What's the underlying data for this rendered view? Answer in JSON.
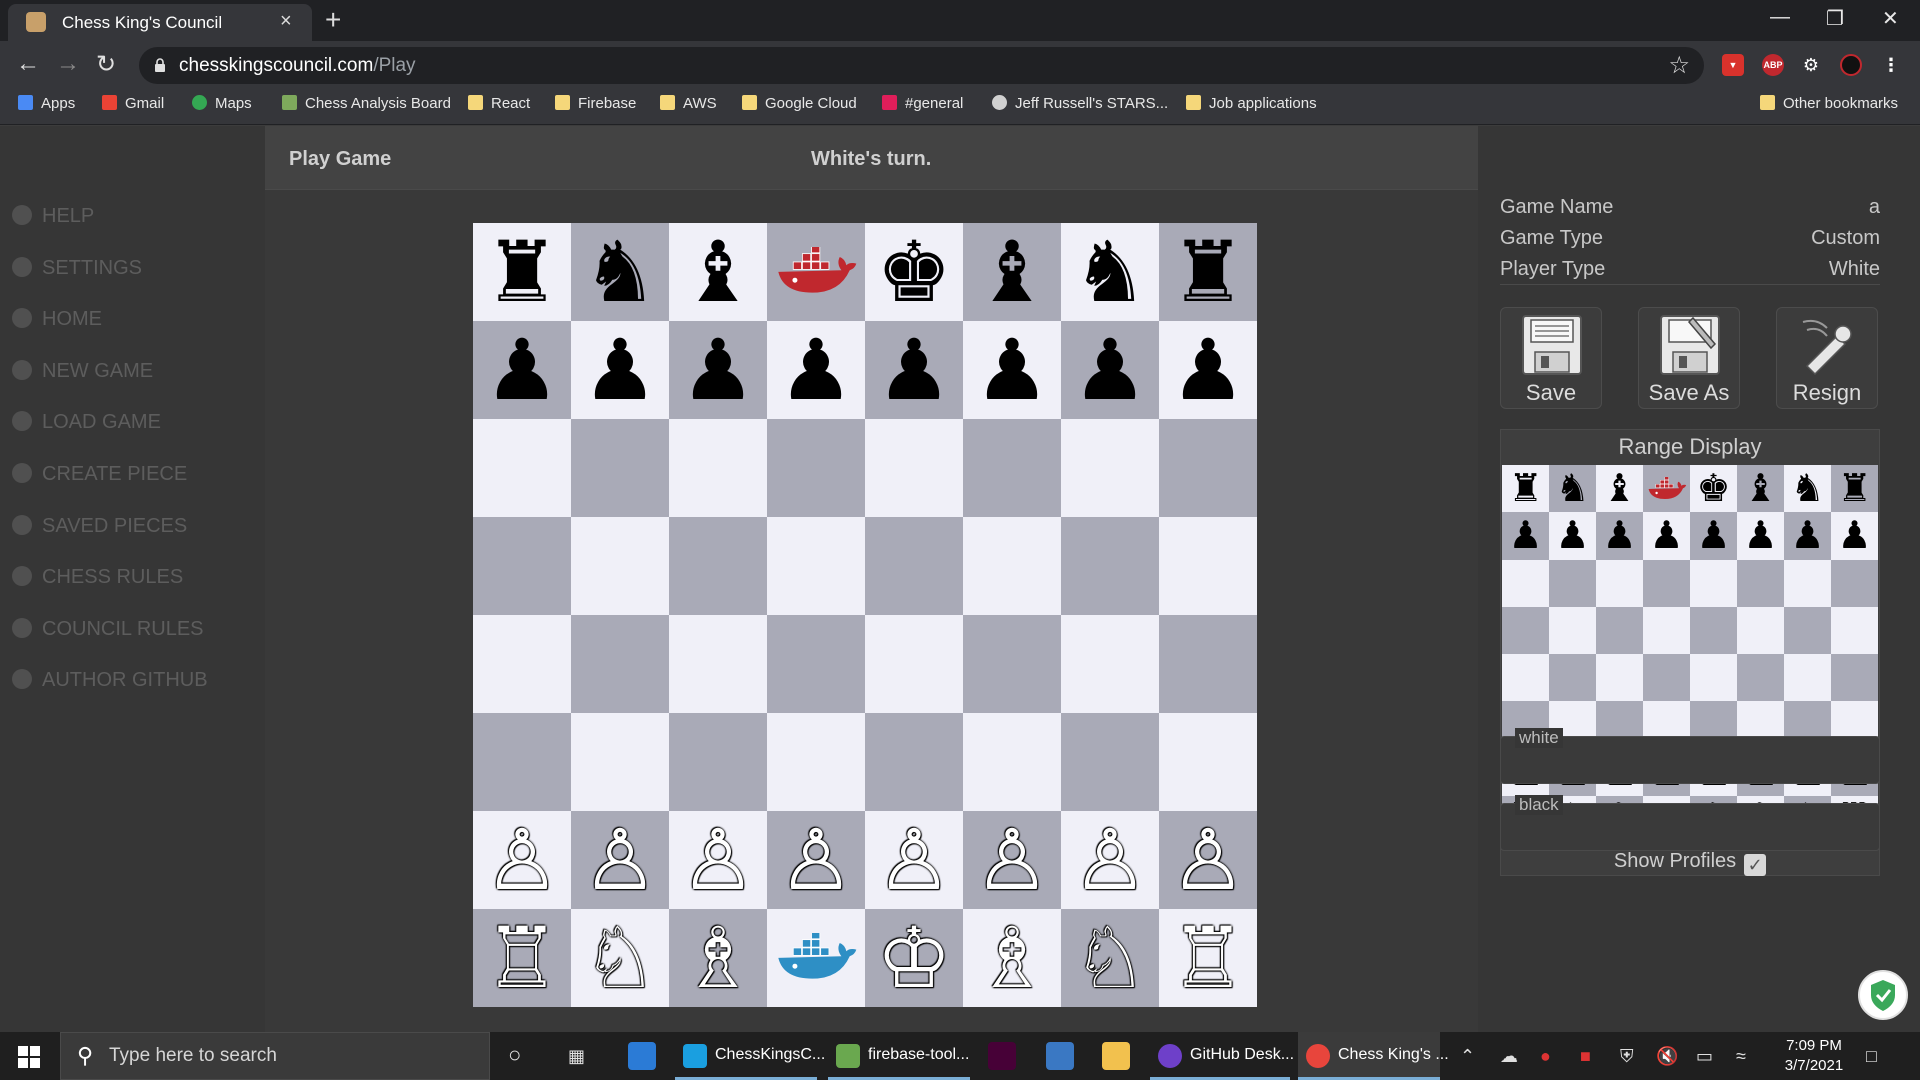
{
  "browser": {
    "tab_title": "Chess King's Council",
    "tab_close": "×",
    "new_tab": "+",
    "url_host": "chesskingscouncil.com",
    "url_path": "/Play",
    "ext_abp": "ABP",
    "bookmarks": [
      {
        "label": "Apps",
        "icon": "apps-grid-icon"
      },
      {
        "label": "Gmail",
        "icon": "gmail-icon"
      },
      {
        "label": "Maps",
        "icon": "maps-icon"
      },
      {
        "label": "Chess Analysis Board",
        "icon": "chess-pawn-icon"
      },
      {
        "label": "React",
        "icon": "folder-icon"
      },
      {
        "label": "Firebase",
        "icon": "folder-icon"
      },
      {
        "label": "AWS",
        "icon": "folder-icon"
      },
      {
        "label": "Google Cloud",
        "icon": "folder-icon"
      },
      {
        "label": "#general",
        "icon": "slack-icon"
      },
      {
        "label": "Jeff Russell's STARS...",
        "icon": "globe-icon"
      },
      {
        "label": "Job applications",
        "icon": "folder-icon"
      }
    ],
    "other_bookmarks": "Other bookmarks"
  },
  "sidebar": {
    "items": [
      {
        "label": "HELP",
        "icon": "help-icon"
      },
      {
        "label": "SETTINGS",
        "icon": "gear-icon"
      },
      {
        "label": "HOME",
        "icon": "home-icon"
      },
      {
        "label": "NEW GAME",
        "icon": "pawn-icon"
      },
      {
        "label": "LOAD GAME",
        "icon": "rook-icon"
      },
      {
        "label": "CREATE PIECE",
        "icon": "crown-icon"
      },
      {
        "label": "SAVED PIECES",
        "icon": "bishop-icon"
      },
      {
        "label": "CHESS RULES",
        "icon": "knight-icon"
      },
      {
        "label": "COUNCIL RULES",
        "icon": "king-icon"
      },
      {
        "label": "AUTHOR GITHUB",
        "icon": "github-icon"
      }
    ]
  },
  "main": {
    "title": "Play Game",
    "turn_status": "White's turn."
  },
  "board": {
    "rows": [
      [
        "♜",
        "♞",
        "♝",
        "docker",
        "♚",
        "♝",
        "♞",
        "♜"
      ],
      [
        "♟",
        "♟",
        "♟",
        "♟",
        "♟",
        "♟",
        "♟",
        "♟"
      ],
      [
        "",
        "",
        "",
        "",
        "",
        "",
        "",
        ""
      ],
      [
        "",
        "",
        "",
        "",
        "",
        "",
        "",
        ""
      ],
      [
        "",
        "",
        "",
        "",
        "",
        "",
        "",
        ""
      ],
      [
        "",
        "",
        "",
        "",
        "",
        "",
        "",
        ""
      ],
      [
        "♙",
        "♙",
        "♙",
        "♙",
        "♙",
        "♙",
        "♙",
        "♙"
      ],
      [
        "♖",
        "♘",
        "♗",
        "docker",
        "♔",
        "♗",
        "♘",
        "♖"
      ]
    ],
    "light_color": "#f0f0f8",
    "dark_color": "#a9aab7",
    "custom_piece_black_color": "#c0282e",
    "custom_piece_white_color": "#2e8fc5"
  },
  "info": {
    "game_name_label": "Game Name",
    "game_name_value": "a",
    "game_type_label": "Game Type",
    "game_type_value": "Custom",
    "player_type_label": "Player Type",
    "player_type_value": "White"
  },
  "actions": {
    "save": "Save",
    "save_as": "Save As",
    "resign": "Resign"
  },
  "range_display": {
    "title": "Range Display",
    "show_profiles": "Show Profiles",
    "show_profiles_checked": true
  },
  "profiles": {
    "white_label": "white",
    "black_label": "black"
  },
  "taskbar": {
    "search_placeholder": "Type here to search",
    "apps": [
      {
        "label": "ChessKingsC...",
        "icon": "webstorm-icon"
      },
      {
        "label": "firebase-tool...",
        "icon": "nodejs-icon"
      },
      {
        "label": "GitHub Desk...",
        "icon": "github-desktop-icon"
      },
      {
        "label": "Chess King's ...",
        "icon": "chrome-icon"
      }
    ],
    "time": "7:09 PM",
    "date": "3/7/2021"
  }
}
